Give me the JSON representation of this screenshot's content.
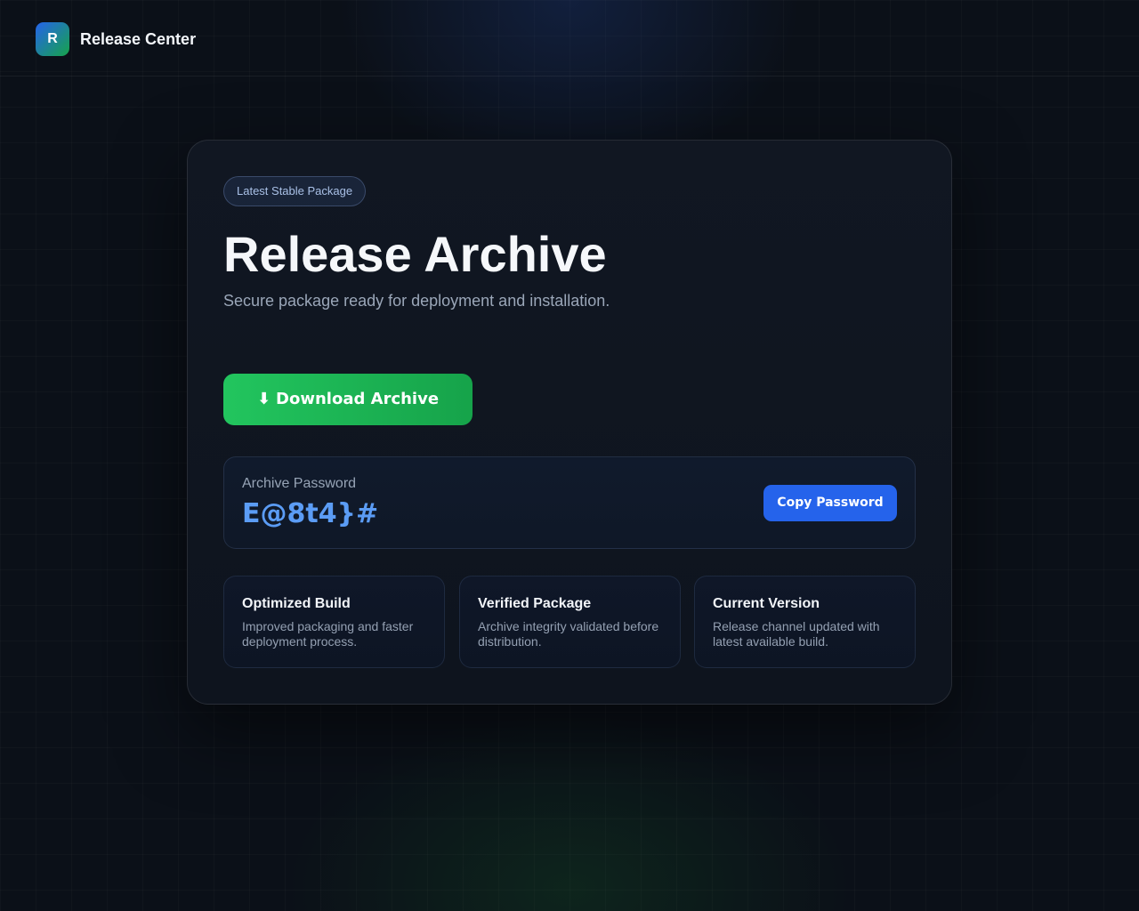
{
  "header": {
    "logo_letter": "R",
    "app_title": "Release Center"
  },
  "card": {
    "badge": "Latest Stable Package",
    "title": "Release Archive",
    "subtitle": "Secure package ready for deployment and installation.",
    "download": {
      "icon": "⬇",
      "label": "Download Archive"
    },
    "password": {
      "label": "Archive Password",
      "value": "E@8t4}#",
      "copy_label": "Copy Password"
    },
    "features": [
      {
        "title": "Optimized Build",
        "description": "Improved packaging and faster deployment process."
      },
      {
        "title": "Verified Package",
        "description": "Archive integrity validated before distribution."
      },
      {
        "title": "Current Version",
        "description": "Release channel updated with latest available build."
      }
    ]
  },
  "colors": {
    "background": "#0b1018",
    "card": "#111722",
    "primary_green": "#22c55e",
    "accent_blue": "#2563eb",
    "password_text": "#5b9cf5"
  },
  "icons": {
    "download_icon": "download-arrow"
  }
}
